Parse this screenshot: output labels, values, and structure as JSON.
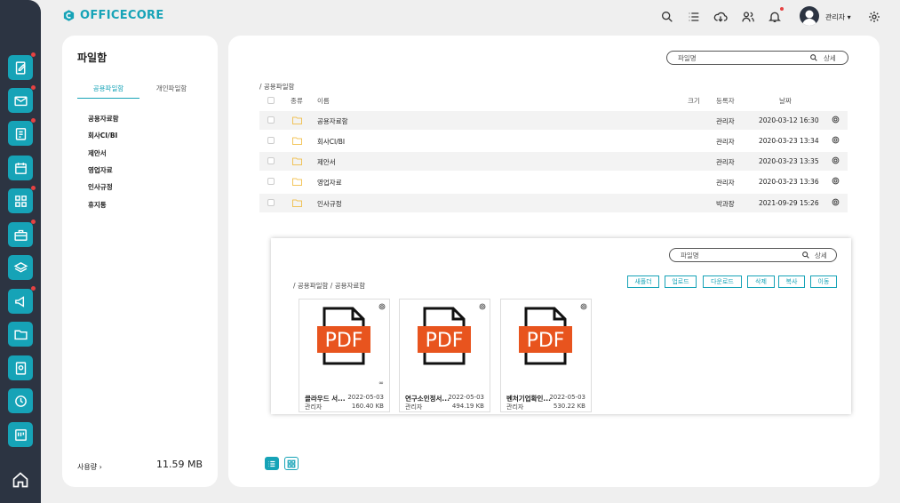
{
  "app": {
    "logo_text": "OFFICECORE",
    "accent": "#16a3b7",
    "sidebar_bg": "#2c3442"
  },
  "topbar": {
    "icons": [
      "search-icon",
      "list-icon",
      "cloud-download-icon",
      "users-icon",
      "bell-icon",
      "settings-icon"
    ],
    "user_name": "관리자 ▾"
  },
  "sidebar": {
    "items": [
      "edit-doc-icon",
      "mail-icon",
      "clipboard-icon",
      "calendar-icon",
      "apps-grid-icon",
      "briefcase-icon",
      "layers-icon",
      "megaphone-icon",
      "folder-icon",
      "phone-book-icon",
      "clock-icon",
      "board-icon"
    ],
    "home_icon": "home-icon"
  },
  "left_panel": {
    "title": "파일함",
    "tabs": [
      {
        "label": "공용파일함",
        "active": true
      },
      {
        "label": "개인파일함",
        "active": false
      }
    ],
    "folders": [
      "공용자료함",
      "회사CI/BI",
      "제안서",
      "영업자료",
      "인사규정",
      "휴지통"
    ],
    "usage_label": "사용량 ›",
    "usage_value": "11.59 MB"
  },
  "main": {
    "search": {
      "placeholder": "파일명",
      "detail": "상세"
    },
    "breadcrumb": "/ 공용파일함",
    "columns": {
      "type": "종류",
      "name": "이름",
      "size": "크기",
      "owner": "등록자",
      "date": "날짜"
    },
    "rows": [
      {
        "name": "공용자료함",
        "owner": "관리자",
        "date": "2020-03-12 16:30"
      },
      {
        "name": "회사CI/BI",
        "owner": "관리자",
        "date": "2020-03-23 13:34"
      },
      {
        "name": "제안서",
        "owner": "관리자",
        "date": "2020-03-23 13:35"
      },
      {
        "name": "영업자료",
        "owner": "관리자",
        "date": "2020-03-23 13:36"
      },
      {
        "name": "인사규정",
        "owner": "박과장",
        "date": "2021-09-29 15:26"
      }
    ]
  },
  "overlay": {
    "search": {
      "placeholder": "파일명",
      "detail": "상세"
    },
    "breadcrumb": "/ 공용파일함 / 공용자료함",
    "actions": [
      "새폴더",
      "업로드",
      "다운로드",
      "삭제",
      "복사",
      "이동"
    ],
    "files": [
      {
        "name": "클라우드 서...",
        "date": "2022-05-03",
        "owner": "관리자",
        "size": "160.40 KB",
        "extra": "∞",
        "badge": "PDF"
      },
      {
        "name": "연구소인정서...",
        "date": "2022-05-03",
        "owner": "관리자",
        "size": "494.19 KB",
        "extra": "",
        "badge": "PDF"
      },
      {
        "name": "벤처기업확인...",
        "date": "2022-05-03",
        "owner": "관리자",
        "size": "530.22 KB",
        "extra": "",
        "badge": "PDF"
      }
    ]
  }
}
